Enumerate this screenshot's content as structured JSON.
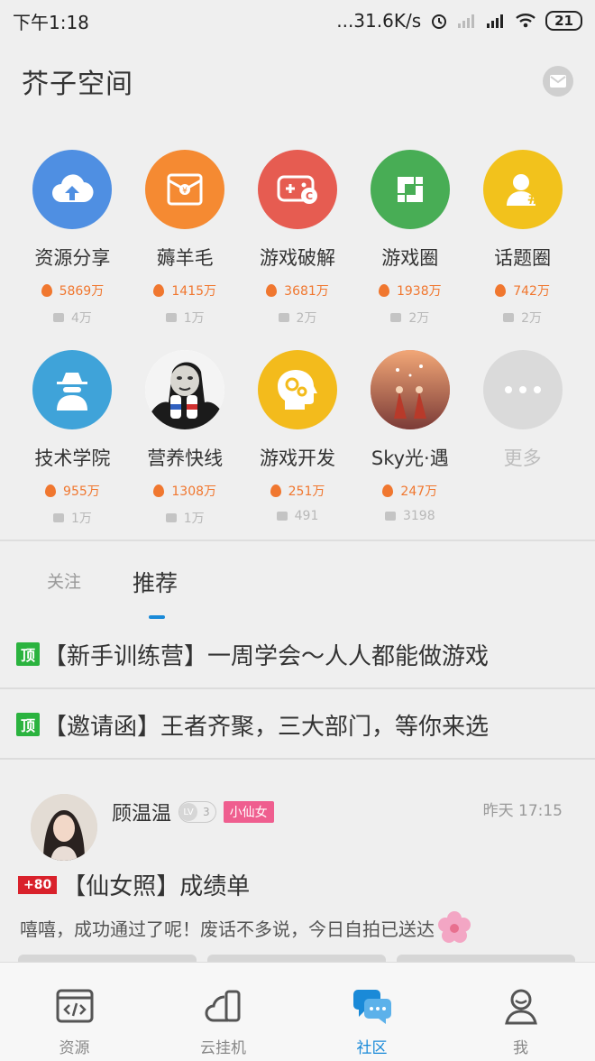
{
  "status_bar": {
    "time": "下午1:18",
    "network_speed": "...31.6K/s",
    "battery": "21"
  },
  "header": {
    "title": "芥子空间"
  },
  "categories": [
    {
      "name": "资源分享",
      "hot": "5869万",
      "posts": "4万",
      "color": "#4f8fe2",
      "icon": "cloud-upload-icon"
    },
    {
      "name": "薅羊毛",
      "hot": "1415万",
      "posts": "1万",
      "color": "#f58a32",
      "icon": "red-envelope-icon"
    },
    {
      "name": "游戏破解",
      "hot": "3681万",
      "posts": "2万",
      "color": "#e65c51",
      "icon": "gamepad-icon"
    },
    {
      "name": "游戏圈",
      "hot": "1938万",
      "posts": "2万",
      "color": "#48ad55",
      "icon": "ring-logo-icon"
    },
    {
      "name": "话题圈",
      "hot": "742万",
      "posts": "2万",
      "color": "#f2c21c",
      "icon": "user-hashtag-icon"
    },
    {
      "name": "技术学院",
      "hot": "955万",
      "posts": "1万",
      "color": "#3fa3d9",
      "icon": "spy-icon"
    },
    {
      "name": "营养快线",
      "hot": "1308万",
      "posts": "1万",
      "color": "#ffffff",
      "icon": "meme-face-icon"
    },
    {
      "name": "游戏开发",
      "hot": "251万",
      "posts": "491",
      "color": "#f3bb1c",
      "icon": "head-gears-icon"
    },
    {
      "name": "Sky光·遇",
      "hot": "247万",
      "posts": "3198",
      "color": "#d9705f",
      "icon": "sky-artwork-icon"
    },
    {
      "name": "更多",
      "color": "#dadada",
      "icon": "more-dots-icon"
    }
  ],
  "tabs": [
    {
      "label": "关注"
    },
    {
      "label": "推荐"
    }
  ],
  "pinned": [
    {
      "badge": "顶",
      "text": "【新手训练营】一周学会～人人都能做游戏"
    },
    {
      "badge": "顶",
      "text": "【邀请函】王者齐聚，三大部门，等你来选"
    }
  ],
  "post": {
    "author": "顾温温",
    "level_prefix": "LV",
    "level": "3",
    "tag": "小仙女",
    "time": "昨天 17:15",
    "score": "+80",
    "title": "【仙女照】成绩单",
    "body": "嘻嘻，成功通过了呢！废话不多说，今日自拍已送达"
  },
  "bottom_nav": [
    {
      "label": "资源",
      "icon": "code-icon"
    },
    {
      "label": "云挂机",
      "icon": "cloud-phone-icon"
    },
    {
      "label": "社区",
      "icon": "chat-bubbles-icon",
      "active": true
    },
    {
      "label": "我",
      "icon": "profile-icon"
    }
  ],
  "colors": {
    "accent": "#1a8ad8",
    "hot": "#f0772f",
    "pin": "#2bb33f",
    "score": "#d9212b",
    "tag": "#ef5e8f"
  }
}
